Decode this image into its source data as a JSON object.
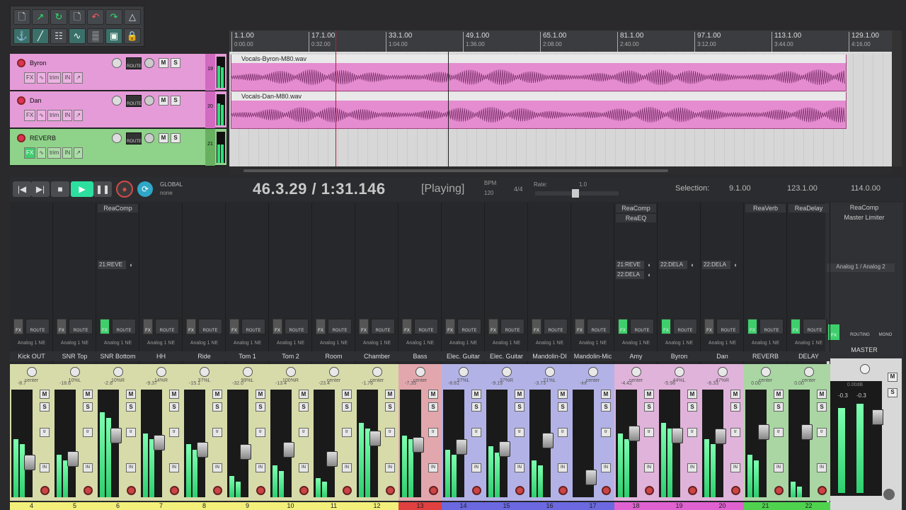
{
  "toolbar": {
    "buttons": [
      "new-project",
      "open",
      "save",
      "save-as",
      "undo",
      "redo",
      "metronome",
      "snap",
      "ripple",
      "grid",
      "item-lock",
      "env-lock",
      "auto-crossfade",
      "trim",
      "lock",
      "settings"
    ]
  },
  "tracks": [
    {
      "name": "Byron",
      "num": "19",
      "color": "#e59bd8",
      "wave_color": "#d26ac0"
    },
    {
      "name": "Dan",
      "num": "20",
      "color": "#e59bd8",
      "wave_color": "#d26ac0"
    },
    {
      "name": "REVERB",
      "num": "21",
      "color": "#8fd28a",
      "wave_color": "#66b060"
    }
  ],
  "track_common": {
    "fx": "FX",
    "route": "ROUTE",
    "trim": "trim",
    "in": "IN",
    "m": "M",
    "s": "S"
  },
  "items": [
    {
      "name": "Vocals-Byron-M80.wav"
    },
    {
      "name": "Vocals-Dan-M80.wav"
    }
  ],
  "ruler": [
    {
      "bar": "1.1.00",
      "time": "0:00.00"
    },
    {
      "bar": "17.1.00",
      "time": "0:32.00"
    },
    {
      "bar": "33.1.00",
      "time": "1:04.00"
    },
    {
      "bar": "49.1.00",
      "time": "1:36.00"
    },
    {
      "bar": "65.1.00",
      "time": "2:08.00"
    },
    {
      "bar": "81.1.00",
      "time": "2:40.00"
    },
    {
      "bar": "97.1.00",
      "time": "3:12.00"
    },
    {
      "bar": "113.1.00",
      "time": "3:44.00"
    },
    {
      "bar": "129.1.00",
      "time": "4:16.00"
    }
  ],
  "transport": {
    "global_label": "GLOBAL",
    "global_value": "none",
    "time_position": "46.3.29 / 1:31.146",
    "play_state": "[Playing]",
    "bpm_label": "BPM",
    "bpm": "120",
    "time_sig": "4/4",
    "rate_label": "Rate:",
    "rate": "1.0",
    "selection_label": "Selection:",
    "sel_start": "9.1.00",
    "sel_end": "123.1.00",
    "sel_length": "114.0.00"
  },
  "mixer": {
    "channels": [
      {
        "name": "Kick OUT",
        "num": "4",
        "pan": "center",
        "peak": "-8.7",
        "fx": [
          "",
          ""
        ],
        "send": "",
        "fader_pos": 0.72,
        "meter": [
          0.55,
          0.5
        ],
        "color": "#d7dba9",
        "numcolor": "#f2f07a",
        "fxon": false
      },
      {
        "name": "SNR Top",
        "num": "5",
        "pan": "10%L",
        "peak": "-18.6",
        "fx": [
          "",
          ""
        ],
        "send": "",
        "fader_pos": 0.68,
        "meter": [
          0.4,
          0.35
        ],
        "color": "#d7dba9",
        "numcolor": "#f2f07a",
        "fxon": false
      },
      {
        "name": "SNR Bottom",
        "num": "6",
        "pan": "10%R",
        "peak": "-2.8",
        "fx": [
          "ReaComp",
          ""
        ],
        "send": "21:REVE",
        "fader_pos": 0.42,
        "meter": [
          0.8,
          0.75
        ],
        "color": "#d7dba9",
        "numcolor": "#f2f07a",
        "fxon": true
      },
      {
        "name": "HH",
        "num": "7",
        "pan": "14%R",
        "peak": "-9.37",
        "fx": [
          "",
          ""
        ],
        "send": "",
        "fader_pos": 0.5,
        "meter": [
          0.6,
          0.55
        ],
        "color": "#d7dba9",
        "numcolor": "#f2f07a",
        "fxon": false
      },
      {
        "name": "Ride",
        "num": "8",
        "pan": "37%L",
        "peak": "-15.1",
        "fx": [
          "",
          ""
        ],
        "send": "",
        "fader_pos": 0.58,
        "meter": [
          0.5,
          0.45
        ],
        "color": "#d7dba9",
        "numcolor": "#f2f07a",
        "fxon": false
      },
      {
        "name": "Tom 1",
        "num": "9",
        "pan": "99%L",
        "peak": "-32.0",
        "fx": [
          "",
          ""
        ],
        "send": "",
        "fader_pos": 0.6,
        "meter": [
          0.2,
          0.15
        ],
        "color": "#d7dba9",
        "numcolor": "#f2f07a",
        "fxon": false
      },
      {
        "name": "Tom 2",
        "num": "10",
        "pan": "100%R",
        "peak": "-13.4",
        "fx": [
          "",
          ""
        ],
        "send": "",
        "fader_pos": 0.58,
        "meter": [
          0.3,
          0.25
        ],
        "color": "#d7dba9",
        "numcolor": "#f2f07a",
        "fxon": false
      },
      {
        "name": "Room",
        "num": "11",
        "pan": "center",
        "peak": "-23.4",
        "fx": [
          "",
          ""
        ],
        "send": "",
        "fader_pos": 0.68,
        "meter": [
          0.18,
          0.15
        ],
        "color": "#d7dba9",
        "numcolor": "#f2f07a",
        "fxon": false
      },
      {
        "name": "Chamber",
        "num": "12",
        "pan": "center",
        "peak": "-1.76",
        "fx": [
          "",
          ""
        ],
        "send": "",
        "fader_pos": 0.45,
        "meter": [
          0.7,
          0.65
        ],
        "color": "#d7dba9",
        "numcolor": "#f2f07a",
        "fxon": false
      },
      {
        "name": "Bass",
        "num": "13",
        "pan": "center",
        "peak": "-7.35",
        "fx": [
          "",
          ""
        ],
        "send": "",
        "fader_pos": 0.52,
        "meter": [
          0.58,
          0.55
        ],
        "color": "#e2a7ad",
        "numcolor": "#e04040",
        "fxon": false
      },
      {
        "name": "Elec. Guitar",
        "num": "14",
        "pan": "37%L",
        "peak": "-8.81",
        "fx": [
          "",
          ""
        ],
        "send": "",
        "fader_pos": 0.55,
        "meter": [
          0.45,
          0.4
        ],
        "color": "#b3b2e6",
        "numcolor": "#6b68e0",
        "fxon": false
      },
      {
        "name": "Elec. Guitar",
        "num": "15",
        "pan": "37%R",
        "peak": "-9.19",
        "fx": [
          "",
          ""
        ],
        "send": "",
        "fader_pos": 0.57,
        "meter": [
          0.48,
          0.42
        ],
        "color": "#b3b2e6",
        "numcolor": "#6b68e0",
        "fxon": false
      },
      {
        "name": "Mandolin-DI",
        "num": "16",
        "pan": "21%L",
        "peak": "-3.73",
        "fx": [
          "",
          ""
        ],
        "send": "",
        "fader_pos": 0.48,
        "meter": [
          0.35,
          0.3
        ],
        "color": "#b3b2e6",
        "numcolor": "#6b68e0",
        "fxon": false
      },
      {
        "name": "Mandolin-Mic",
        "num": "17",
        "pan": "center",
        "peak": "-inf",
        "fx": [
          "",
          ""
        ],
        "send": "",
        "fader_pos": 0.88,
        "meter": [
          0.0,
          0.0
        ],
        "color": "#b3b2e6",
        "numcolor": "#6b68e0",
        "fxon": false
      },
      {
        "name": "Amy",
        "num": "18",
        "pan": "center",
        "peak": "-4.42",
        "fx": [
          "ReaComp",
          "ReaEQ"
        ],
        "send": "21:REVE",
        "send2": "22:DELA",
        "fader_pos": 0.4,
        "meter": [
          0.6,
          0.55
        ],
        "color": "#e0b3da",
        "numcolor": "#e062d0",
        "fxon": true
      },
      {
        "name": "Byron",
        "num": "19",
        "pan": "44%L",
        "peak": "-5.98",
        "fx": [
          "",
          ""
        ],
        "send": "22:DELA",
        "fader_pos": 0.42,
        "meter": [
          0.7,
          0.65
        ],
        "color": "#e0b3da",
        "numcolor": "#e062d0",
        "fxon": true
      },
      {
        "name": "Dan",
        "num": "20",
        "pan": "47%R",
        "peak": "-6.33",
        "fx": [
          "",
          ""
        ],
        "send": "22:DELA",
        "fader_pos": 0.43,
        "meter": [
          0.55,
          0.5
        ],
        "color": "#e0b3da",
        "numcolor": "#e062d0",
        "fxon": false
      },
      {
        "name": "REVERB",
        "num": "21",
        "pan": "center",
        "peak": "0.00",
        "fx": [
          "ReaVerb",
          ""
        ],
        "send": "",
        "fader_pos": 0.38,
        "meter": [
          0.4,
          0.35
        ],
        "color": "#a9d6a3",
        "numcolor": "#4fd34f",
        "fxon": true
      },
      {
        "name": "DELAY",
        "num": "22",
        "pan": "center",
        "peak": "0.00",
        "fx": [
          "ReaDelay",
          ""
        ],
        "send": "",
        "fader_pos": 0.38,
        "meter": [
          0.15,
          0.1
        ],
        "color": "#a9d6a3",
        "numcolor": "#4fd34f",
        "fxon": true
      }
    ],
    "master": {
      "name": "MASTER",
      "fx": [
        "ReaComp",
        "Master Limiter"
      ],
      "output": "Analog 1 / Analog 2",
      "route": "ROUTING",
      "mono": "MONO",
      "peak": "0.00dB",
      "lr": [
        "-0.3",
        "-0.3"
      ]
    }
  },
  "mixer_common": {
    "input": "Analog 1 NE",
    "route": "ROUTE",
    "fx": "FX",
    "m": "M",
    "s": "S",
    "tr": "tr",
    "in": "IN"
  }
}
